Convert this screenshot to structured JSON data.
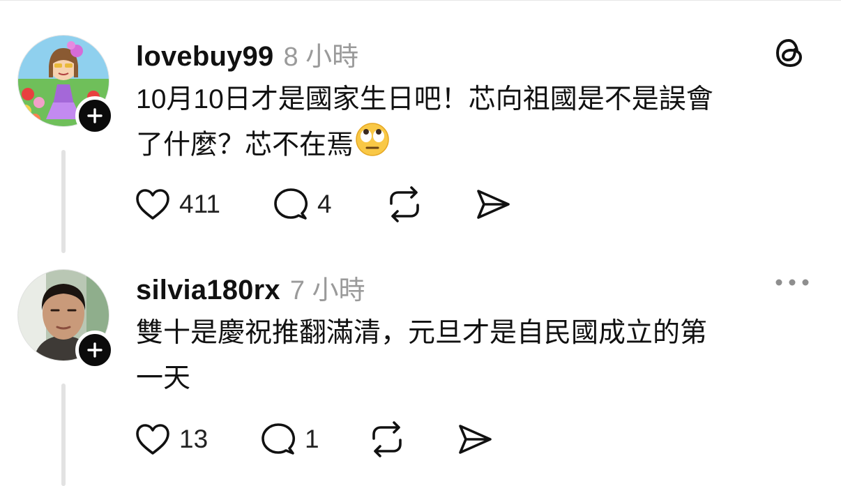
{
  "app": {
    "logo_icon": "threads-logo-icon"
  },
  "colors": {
    "text": "#111111",
    "muted": "#9a9a9a",
    "follow_badge": "#0b0b0b",
    "thread_line": "#e2e2e2"
  },
  "posts": [
    {
      "username": "lovebuy99",
      "timestamp": "8 小時",
      "text_line1": "10月10日才是國家生日吧！芯向祖國是不是誤會",
      "text_line2": "了什麼？芯不在焉",
      "emoji": "face-with-rolling-eyes",
      "likes": "411",
      "replies": "4"
    },
    {
      "username": "silvia180rx",
      "timestamp": "7 小時",
      "text_line1": "雙十是慶祝推翻滿清，元旦才是自民國成立的第",
      "text_line2": "一天",
      "likes": "13",
      "replies": "1"
    }
  ]
}
